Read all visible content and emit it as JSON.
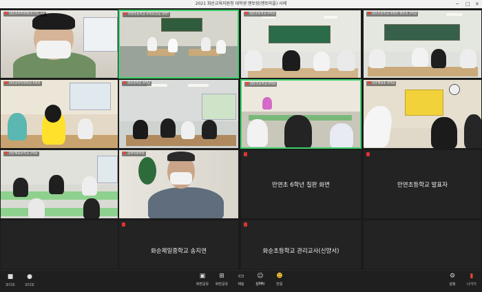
{
  "window": {
    "title": "2021 화순교육지원청 대학생 멘토링(멘토마을) 사례"
  },
  "tiles": [
    {
      "label": "화순교육지원청(호스트, 나)"
    },
    {
      "label": "만연초등학교 6학년(교실 화면)"
    },
    {
      "label": "화순초등학교 6학년"
    },
    {
      "label": "화순초등학교 대표단 멘토링 2학년"
    },
    {
      "label": "화순교육지원청교 6학년"
    },
    {
      "label": "화순중학교 6학년"
    },
    {
      "label": "화순초등학교 6학년"
    },
    {
      "label": "화순제일중 6학년"
    },
    {
      "label": "화순제일중학교 2학년"
    },
    {
      "label": "교육지원과장"
    },
    {
      "name": "만연초 6학년 칠판 화면"
    },
    {
      "name": "만연초등학교 발표자"
    },
    {
      "name": "화순제일중학교 송지연"
    },
    {
      "name": "화순초등학교 관리교사(신양서)"
    }
  ],
  "toolbar": {
    "left": [
      {
        "label": "오디오",
        "icon": "camera-icon"
      },
      {
        "label": "오디오",
        "icon": "mic-icon"
      }
    ],
    "center": [
      {
        "label": "화면공유",
        "icon": "share-screen-icon"
      },
      {
        "label": "화면공유",
        "icon": "share-plus-icon"
      },
      {
        "label": "채팅",
        "icon": "chat-icon"
      },
      {
        "label": "참가자",
        "icon": "participants-icon",
        "count": "14"
      },
      {
        "label": "반응",
        "icon": "emoji-icon"
      }
    ],
    "right": [
      {
        "label": "설정",
        "icon": "gear-icon"
      },
      {
        "label": "나가기",
        "icon": "leave-icon"
      }
    ]
  },
  "colors": {
    "active_border": "#3ad16b",
    "leave": "#e5483a",
    "mic_off": "#dd3333"
  }
}
